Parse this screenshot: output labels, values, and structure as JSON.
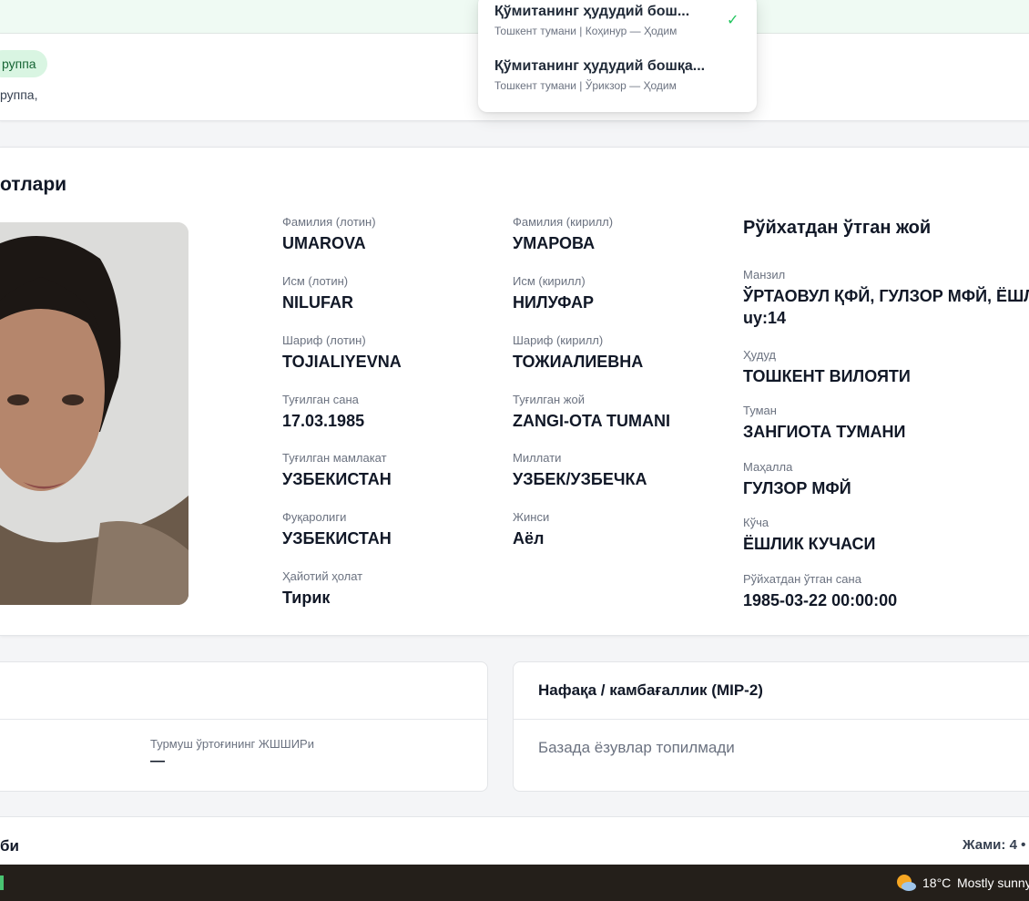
{
  "header": {
    "badge": "руппа",
    "subtitle": "руппа,"
  },
  "dropdown": {
    "items": [
      {
        "title": "Қўмитанинг ҳудудий бош...",
        "subtitle": "Тошкент тумани | Коҳинур — Ҳодим",
        "selected": true
      },
      {
        "title": "Қўмитанинг ҳудудий бошқа...",
        "subtitle": "Тошкент тумани | Ўрикзор — Ҳодим",
        "selected": false
      }
    ],
    "check_icon": "check-icon"
  },
  "person": {
    "section_title": "отлари",
    "col1": [
      {
        "label": "Фамилия (лотин)",
        "value": "UMAROVA"
      },
      {
        "label": "Исм (лотин)",
        "value": "NILUFAR"
      },
      {
        "label": "Шариф (лотин)",
        "value": "TOJIALIYEVNA"
      },
      {
        "label": "Туғилган сана",
        "value": "17.03.1985"
      },
      {
        "label": "Туғилган мамлакат",
        "value": "УЗБЕКИСТАН"
      },
      {
        "label": "Фуқаролиги",
        "value": "УЗБЕКИСТАН"
      },
      {
        "label": "Ҳайотий ҳолат",
        "value": "Тирик"
      }
    ],
    "col2": [
      {
        "label": "Фамилия (кирилл)",
        "value": "УМАРОВА"
      },
      {
        "label": "Исм (кирилл)",
        "value": "НИЛУФАР"
      },
      {
        "label": "Шариф (кирилл)",
        "value": "ТОЖИАЛИЕВНА"
      },
      {
        "label": "Туғилган жой",
        "value": "ZANGI-OTA TUMANI"
      },
      {
        "label": "Миллати",
        "value": "УЗБЕК/УЗБЕЧКА"
      },
      {
        "label": "Жинси",
        "value": "Аёл"
      }
    ]
  },
  "registration": {
    "title": "Рўйхатдан ўтган жой",
    "address": {
      "label": "Манзил",
      "line1": "ЎРТАОВУЛ ҚФЙ, ГУЛЗОР МФЙ, ЁШЛ",
      "line2": "uy:14"
    },
    "fields": [
      {
        "label": "Ҳудуд",
        "value": "ТОШКЕНТ ВИЛОЯТИ"
      },
      {
        "label": "Туман",
        "value": "ЗАНГИОТА ТУМАНИ"
      },
      {
        "label": "Маҳалла",
        "value": "ГУЛЗОР МФЙ"
      },
      {
        "label": "Кўча",
        "value": "ЁШЛИК КУЧАСИ"
      },
      {
        "label": "Рўйхатдан ўтган сана",
        "value": "1985-03-22 00:00:00"
      }
    ]
  },
  "spouse_panel": {
    "label": "Турмуш ўртоғининг ЖШШИРи",
    "value": "—"
  },
  "mip_panel": {
    "title": "Нафақа / камбағаллик (MIP-2)",
    "empty": "Базада ёзувлар топилмади"
  },
  "bottom": {
    "left": "би",
    "right": "Жами: 4 •"
  },
  "taskbar": {
    "temperature": "18°C",
    "condition": "Mostly sunny",
    "weather_icon": "partly-sunny-icon"
  }
}
